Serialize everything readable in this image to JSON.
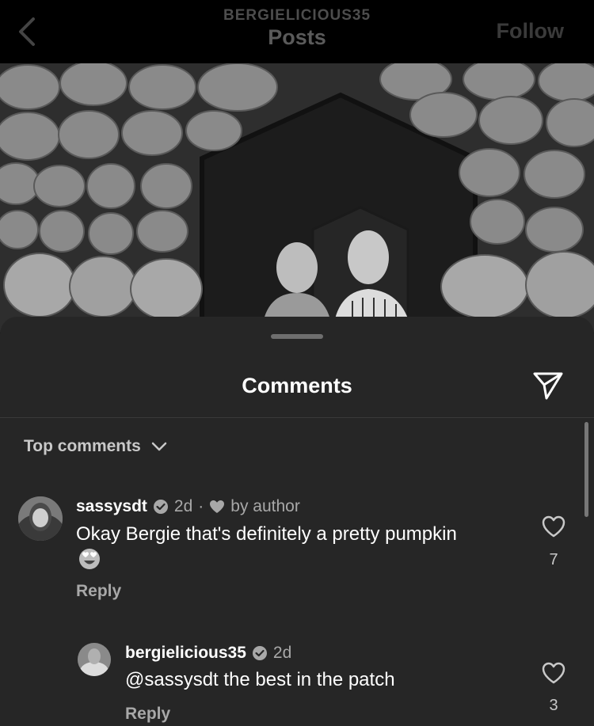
{
  "header": {
    "username": "BERGIELICIOUS35",
    "title": "Posts",
    "follow_label": "Follow",
    "back_icon": "chevron-left-icon"
  },
  "sheet": {
    "title": "Comments",
    "share_icon": "paper-plane-icon",
    "sort_label": "Top comments"
  },
  "comments": [
    {
      "username": "sassysdt",
      "time": "2d",
      "separator": "·",
      "liked_by": "by author",
      "text": "Okay Bergie that's definitely a pretty pumpkin",
      "emoji": "heart-eyes-emoji",
      "reply_label": "Reply",
      "likes": "7"
    },
    {
      "username": "bergielicious35",
      "time": "2d",
      "text": "@sassysdt the best in the patch",
      "reply_label": "Reply",
      "likes": "3"
    }
  ],
  "colors": {
    "background": "#000000",
    "sheet": "#262626",
    "muted_text": "#a8a8a8"
  }
}
